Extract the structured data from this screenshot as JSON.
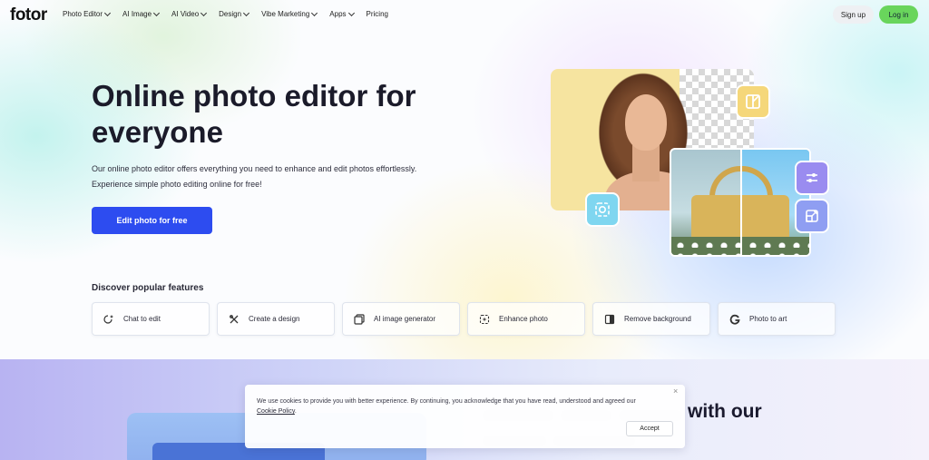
{
  "nav": {
    "logo": "fotor",
    "items": [
      {
        "label": "Photo Editor",
        "has_dropdown": true
      },
      {
        "label": "AI Image",
        "has_dropdown": true
      },
      {
        "label": "AI Video",
        "has_dropdown": true
      },
      {
        "label": "Design",
        "has_dropdown": true
      },
      {
        "label": "Vibe Marketing",
        "has_dropdown": true
      },
      {
        "label": "Apps",
        "has_dropdown": true
      },
      {
        "label": "Pricing",
        "has_dropdown": false
      }
    ],
    "signup_label": "Sign up",
    "login_label": "Log in"
  },
  "hero": {
    "title": "Online photo editor for everyone",
    "description_line1": "Our online photo editor offers everything you need to enhance and edit photos effortlessly.",
    "description_line2": "Experience simple photo editing online for free!",
    "cta_label": "Edit photo for free"
  },
  "features": {
    "heading": "Discover popular features",
    "items": [
      {
        "label": "Chat to edit",
        "icon": "chat-sparkle-icon"
      },
      {
        "label": "Create a design",
        "icon": "design-tools-icon"
      },
      {
        "label": "AI image generator",
        "icon": "image-layers-icon"
      },
      {
        "label": "Enhance photo",
        "icon": "enhance-sparkle-icon"
      },
      {
        "label": "Remove background",
        "icon": "remove-background-icon"
      },
      {
        "label": "Photo to art",
        "icon": "art-g-icon"
      }
    ]
  },
  "lower_section": {
    "heading_fragment": "with our"
  },
  "cookie": {
    "text_before_link": "We use cookies to provide you with better experience. By continuing, you acknowledge that you have read, understood and agreed our ",
    "link_label": "Cookie Policy",
    "text_after_link": ".",
    "close_label": "×",
    "accept_label": "Accept"
  },
  "colors": {
    "primary_cta": "#2d4cf0",
    "login_green": "#69d55c"
  }
}
